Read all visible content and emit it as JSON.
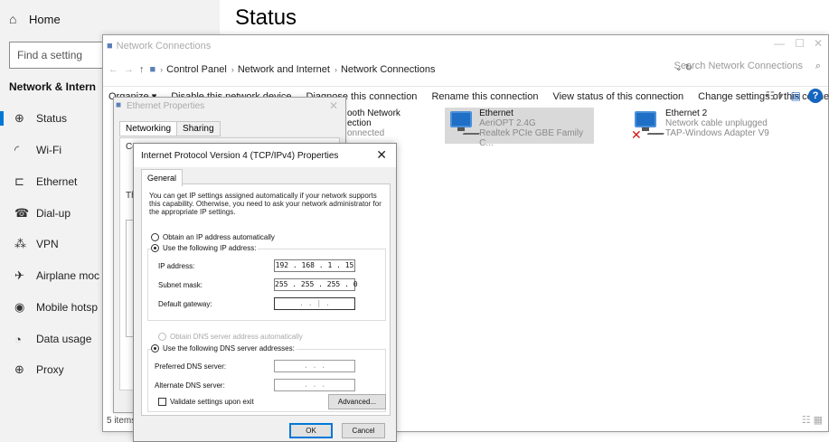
{
  "settings": {
    "home_label": "Home",
    "search_placeholder": "Find a setting",
    "section_title": "Network & Intern",
    "page_title": "Status",
    "nav_items": [
      {
        "label": "Status",
        "icon": "globe-icon"
      },
      {
        "label": "Wi-Fi",
        "icon": "wifi-icon"
      },
      {
        "label": "Ethernet",
        "icon": "ethernet-icon"
      },
      {
        "label": "Dial-up",
        "icon": "dialup-icon"
      },
      {
        "label": "VPN",
        "icon": "vpn-icon"
      },
      {
        "label": "Airplane moc",
        "icon": "airplane-icon"
      },
      {
        "label": "Mobile hotsp",
        "icon": "hotspot-icon"
      },
      {
        "label": "Data usage",
        "icon": "data-usage-icon"
      },
      {
        "label": "Proxy",
        "icon": "proxy-icon"
      }
    ],
    "selected_item": "Status"
  },
  "netwin": {
    "title": "Network Connections",
    "breadcrumb": [
      "Control Panel",
      "Network and Internet",
      "Network Connections"
    ],
    "search_placeholder": "Search Network Connections",
    "toolbar": {
      "organize": "Organize ▾",
      "disable": "Disable this network device",
      "diagnose": "Diagnose this connection",
      "rename": "Rename this connection",
      "view_status": "View status of this connection",
      "change_settings": "Change settings of this connection"
    },
    "adapters": [
      {
        "name": "ooth Network",
        "line2": "ection",
        "line3": "onnected"
      },
      {
        "name": "Ethernet",
        "line2": "AeriOPT 2.4G",
        "line3": "Realtek PCIe GBE Family C..."
      },
      {
        "name": "Ethernet 2",
        "line2": "Network cable unplugged",
        "line3": "TAP-Windows Adapter V9"
      }
    ],
    "status_bar": "5 items"
  },
  "ethernet_properties": {
    "title": "Ethernet Properties",
    "tabs": [
      "Networking",
      "Sharing"
    ],
    "frag_co": "Co",
    "frag_th": "Th"
  },
  "ipv4": {
    "title": "Internet Protocol Version 4 (TCP/IPv4) Properties",
    "tab": "General",
    "description": "You can get IP settings assigned automatically if your network supports this capability. Otherwise, you need to ask your network administrator for the appropriate IP settings.",
    "radio_auto_ip": "Obtain an IP address automatically",
    "radio_static_ip": "Use the following IP address:",
    "ip_label": "IP address:",
    "ip_value": "192 . 168 .  1  . 15",
    "subnet_label": "Subnet mask:",
    "subnet_value": "255 . 255 . 255 .  0",
    "gateway_label": "Default gateway:",
    "gateway_value": " .       .    |  .",
    "radio_auto_dns": "Obtain DNS server address automatically",
    "radio_static_dns": "Use the following DNS server addresses:",
    "preferred_dns_label": "Preferred DNS server:",
    "preferred_dns_value": "  .     .     .  ",
    "alternate_dns_label": "Alternate DNS server:",
    "alternate_dns_value": "  .     .     .  ",
    "validate_label": "Validate settings upon exit",
    "advanced_button": "Advanced...",
    "ok_button": "OK",
    "cancel_button": "Cancel"
  },
  "colors": {
    "accent": "#0078d7",
    "selection": "#d9d9d9",
    "error_x": "#d31717"
  }
}
